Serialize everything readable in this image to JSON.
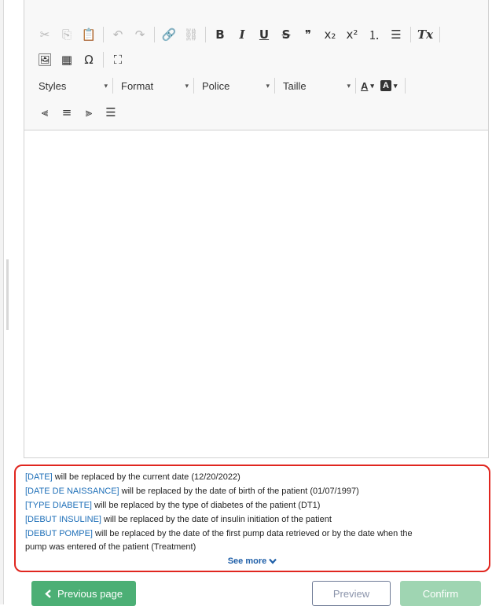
{
  "toolbar": {
    "row1": [
      {
        "name": "cut-icon",
        "glyph": "✂",
        "dim": true
      },
      {
        "name": "copy-icon",
        "glyph": "⎘",
        "dim": true
      },
      {
        "name": "paste-icon",
        "glyph": "📋",
        "dim": false
      },
      {
        "sep": true
      },
      {
        "name": "undo-icon",
        "glyph": "↶",
        "dim": true
      },
      {
        "name": "redo-icon",
        "glyph": "↷",
        "dim": true
      },
      {
        "sep": true
      },
      {
        "name": "link-icon",
        "glyph": "🔗",
        "dim": false
      },
      {
        "name": "unlink-icon",
        "glyph": "⛓",
        "dim": true
      },
      {
        "sep": true
      },
      {
        "name": "bold-button",
        "glyph": "B",
        "cls": "bold"
      },
      {
        "name": "italic-button",
        "glyph": "I",
        "cls": "ital"
      },
      {
        "name": "underline-button",
        "glyph": "U",
        "cls": "under"
      },
      {
        "name": "strike-button",
        "glyph": "S",
        "cls": "strike"
      },
      {
        "name": "blockquote-icon",
        "glyph": "❞",
        "dim": false
      },
      {
        "name": "subscript-icon",
        "glyph": "x₂",
        "dim": false
      },
      {
        "name": "superscript-icon",
        "glyph": "x²",
        "dim": false
      },
      {
        "name": "numbered-list-icon",
        "glyph": "⒈",
        "dim": false
      },
      {
        "name": "bullet-list-icon",
        "glyph": "☰",
        "dim": false
      },
      {
        "sep": true
      },
      {
        "name": "remove-format-icon",
        "glyph": "Tx",
        "cls": "ital"
      },
      {
        "sep": true
      }
    ],
    "row2": [
      {
        "name": "image-icon",
        "glyph": "🖼",
        "dim": false
      },
      {
        "name": "table-icon",
        "glyph": "▦",
        "dim": false
      },
      {
        "name": "special-char-icon",
        "glyph": "Ω",
        "dim": false
      },
      {
        "sep": true
      },
      {
        "name": "maximize-icon",
        "glyph": "⛶",
        "dim": false
      }
    ],
    "combos": {
      "styles": "Styles",
      "format": "Format",
      "police": "Police",
      "taille": "Taille",
      "arrow": "▾"
    },
    "text_color_label": "A",
    "bg_color_label": "A",
    "row4": [
      {
        "name": "align-left-icon",
        "glyph": "⫷"
      },
      {
        "name": "align-center-icon",
        "glyph": "≡"
      },
      {
        "name": "align-right-icon",
        "glyph": "⫸"
      },
      {
        "name": "align-justify-icon",
        "glyph": "☰"
      }
    ]
  },
  "help": {
    "lines": [
      {
        "token": "[DATE]",
        "text": " will be replaced by the current date (12/20/2022)"
      },
      {
        "token": "[DATE DE NAISSANCE]",
        "text": " will be replaced by the date of birth of the patient (01/07/1997)"
      },
      {
        "token": "[TYPE DIABETE]",
        "text": " will be replaced by the type of diabetes of the patient (DT1)"
      },
      {
        "token": "[DEBUT INSULINE]",
        "text": " will be replaced by the date of insulin initiation of the patient"
      },
      {
        "token": "[DEBUT POMPE]",
        "text": " will be replaced by the date of the first pump data retrieved or by the date when the"
      },
      {
        "token": "",
        "text": "pump was entered of the patient (Treatment)"
      }
    ],
    "see_more": "See more",
    "see_more_icon": "chevron-down-icon"
  },
  "buttons": {
    "previous": "Previous page",
    "previous_icon": "chevron-left-icon",
    "preview": "Preview",
    "confirm": "Confirm"
  },
  "colors": {
    "accent_green": "#4caf75",
    "confirm_disabled": "#9fd5b2",
    "highlight_border": "#e0261f",
    "token_blue": "#1e6fb8"
  }
}
